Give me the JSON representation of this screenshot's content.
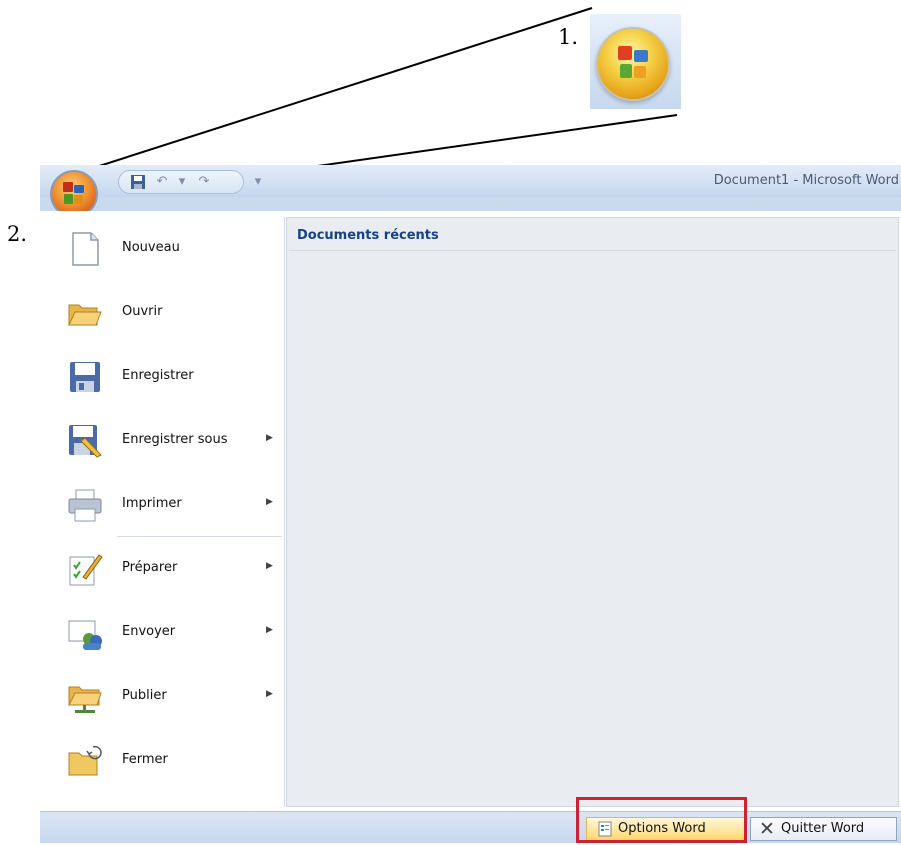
{
  "annotations": {
    "step1": "1.",
    "step2": "2."
  },
  "window": {
    "title": "Document1 - Microsoft Word"
  },
  "menu": {
    "recent_header": "Documents récents",
    "items": [
      {
        "label": "Nouveau",
        "has_submenu": false,
        "icon": "new-document-icon"
      },
      {
        "label": "Ouvrir",
        "has_submenu": false,
        "icon": "open-folder-icon"
      },
      {
        "label": "Enregistrer",
        "has_submenu": false,
        "icon": "save-disk-icon"
      },
      {
        "label": "Enregistrer sous",
        "has_submenu": true,
        "icon": "save-as-icon"
      },
      {
        "label": "Imprimer",
        "has_submenu": true,
        "icon": "printer-icon"
      },
      {
        "label": "Préparer",
        "has_submenu": true,
        "icon": "prepare-pen-icon"
      },
      {
        "label": "Envoyer",
        "has_submenu": true,
        "icon": "send-icon"
      },
      {
        "label": "Publier",
        "has_submenu": true,
        "icon": "publish-folder-icon"
      },
      {
        "label": "Fermer",
        "has_submenu": false,
        "icon": "close-folder-icon"
      }
    ],
    "options_button": "Options Word",
    "quit_button": "Quitter Word"
  },
  "colors": {
    "highlight_box": "#cc2233",
    "title_text": "#4a5a72",
    "recent_header": "#15428b"
  }
}
